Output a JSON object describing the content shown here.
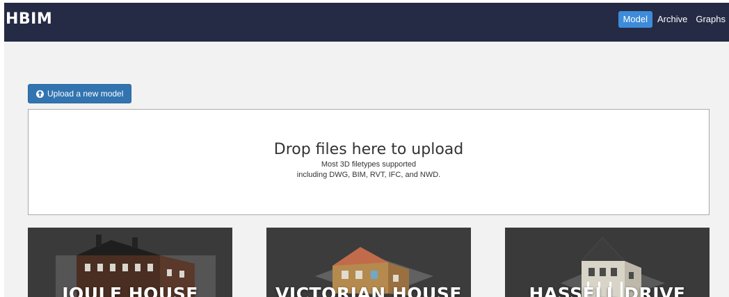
{
  "navbar": {
    "brand": "HBIM",
    "items": [
      {
        "label": "Model",
        "active": true
      },
      {
        "label": "Archive",
        "active": false
      },
      {
        "label": "Graphs",
        "active": false
      }
    ]
  },
  "upload_button": {
    "icon": "upload-circle-icon",
    "label": "Upload a new model"
  },
  "dropzone": {
    "title": "Drop files here to upload",
    "line1": "Most 3D filetypes supported",
    "line2": "including DWG, BIM, RVT, IFC, and NWD."
  },
  "models": [
    {
      "title": "JOULE HOUSE"
    },
    {
      "title": "VICTORIAN HOUSE"
    },
    {
      "title": "HASSELL DRIVE"
    }
  ],
  "colors": {
    "navbar_bg": "#252b45",
    "active_nav": "#3d8bd9",
    "primary_button": "#3274b0",
    "page_bg": "#f2f2f2"
  }
}
